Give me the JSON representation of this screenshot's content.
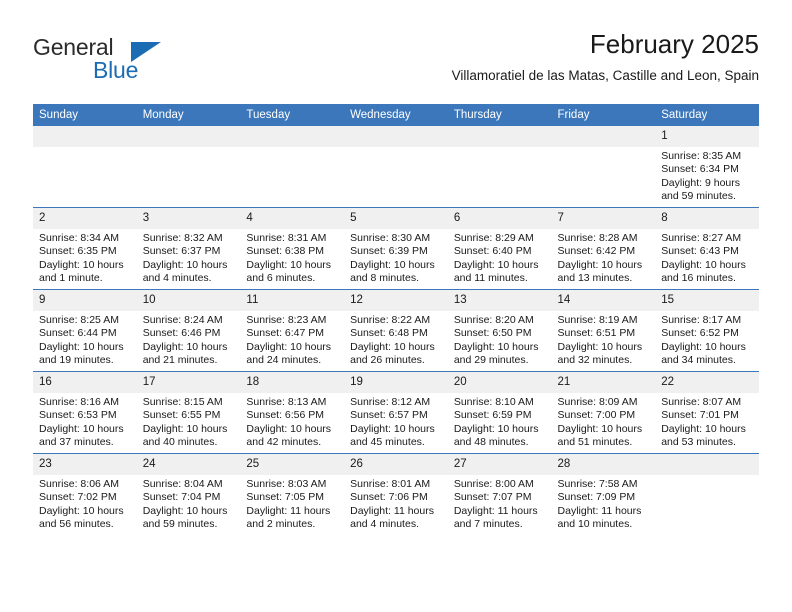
{
  "logo": {
    "word_1": "General",
    "word_2": "Blue",
    "triangle_icon": "blue-triangle-icon",
    "accent_color": "#1b6cb3"
  },
  "header": {
    "title": "February 2025",
    "subtitle": "Villamoratiel de las Matas, Castille and Leon, Spain"
  },
  "theme": {
    "header_blue": "#3b77ba",
    "daynum_gray": "#f0f0f0",
    "text": "#1a1a1a"
  },
  "calendar": {
    "weekday_headers": [
      "Sunday",
      "Monday",
      "Tuesday",
      "Wednesday",
      "Thursday",
      "Friday",
      "Saturday"
    ],
    "weeks": [
      [
        {
          "day": "",
          "sunrise": "",
          "sunset": "",
          "daylight_1": "",
          "daylight_2": ""
        },
        {
          "day": "",
          "sunrise": "",
          "sunset": "",
          "daylight_1": "",
          "daylight_2": ""
        },
        {
          "day": "",
          "sunrise": "",
          "sunset": "",
          "daylight_1": "",
          "daylight_2": ""
        },
        {
          "day": "",
          "sunrise": "",
          "sunset": "",
          "daylight_1": "",
          "daylight_2": ""
        },
        {
          "day": "",
          "sunrise": "",
          "sunset": "",
          "daylight_1": "",
          "daylight_2": ""
        },
        {
          "day": "",
          "sunrise": "",
          "sunset": "",
          "daylight_1": "",
          "daylight_2": ""
        },
        {
          "day": "1",
          "sunrise": "Sunrise: 8:35 AM",
          "sunset": "Sunset: 6:34 PM",
          "daylight_1": "Daylight: 9 hours",
          "daylight_2": "and 59 minutes."
        }
      ],
      [
        {
          "day": "2",
          "sunrise": "Sunrise: 8:34 AM",
          "sunset": "Sunset: 6:35 PM",
          "daylight_1": "Daylight: 10 hours",
          "daylight_2": "and 1 minute."
        },
        {
          "day": "3",
          "sunrise": "Sunrise: 8:32 AM",
          "sunset": "Sunset: 6:37 PM",
          "daylight_1": "Daylight: 10 hours",
          "daylight_2": "and 4 minutes."
        },
        {
          "day": "4",
          "sunrise": "Sunrise: 8:31 AM",
          "sunset": "Sunset: 6:38 PM",
          "daylight_1": "Daylight: 10 hours",
          "daylight_2": "and 6 minutes."
        },
        {
          "day": "5",
          "sunrise": "Sunrise: 8:30 AM",
          "sunset": "Sunset: 6:39 PM",
          "daylight_1": "Daylight: 10 hours",
          "daylight_2": "and 8 minutes."
        },
        {
          "day": "6",
          "sunrise": "Sunrise: 8:29 AM",
          "sunset": "Sunset: 6:40 PM",
          "daylight_1": "Daylight: 10 hours",
          "daylight_2": "and 11 minutes."
        },
        {
          "day": "7",
          "sunrise": "Sunrise: 8:28 AM",
          "sunset": "Sunset: 6:42 PM",
          "daylight_1": "Daylight: 10 hours",
          "daylight_2": "and 13 minutes."
        },
        {
          "day": "8",
          "sunrise": "Sunrise: 8:27 AM",
          "sunset": "Sunset: 6:43 PM",
          "daylight_1": "Daylight: 10 hours",
          "daylight_2": "and 16 minutes."
        }
      ],
      [
        {
          "day": "9",
          "sunrise": "Sunrise: 8:25 AM",
          "sunset": "Sunset: 6:44 PM",
          "daylight_1": "Daylight: 10 hours",
          "daylight_2": "and 19 minutes."
        },
        {
          "day": "10",
          "sunrise": "Sunrise: 8:24 AM",
          "sunset": "Sunset: 6:46 PM",
          "daylight_1": "Daylight: 10 hours",
          "daylight_2": "and 21 minutes."
        },
        {
          "day": "11",
          "sunrise": "Sunrise: 8:23 AM",
          "sunset": "Sunset: 6:47 PM",
          "daylight_1": "Daylight: 10 hours",
          "daylight_2": "and 24 minutes."
        },
        {
          "day": "12",
          "sunrise": "Sunrise: 8:22 AM",
          "sunset": "Sunset: 6:48 PM",
          "daylight_1": "Daylight: 10 hours",
          "daylight_2": "and 26 minutes."
        },
        {
          "day": "13",
          "sunrise": "Sunrise: 8:20 AM",
          "sunset": "Sunset: 6:50 PM",
          "daylight_1": "Daylight: 10 hours",
          "daylight_2": "and 29 minutes."
        },
        {
          "day": "14",
          "sunrise": "Sunrise: 8:19 AM",
          "sunset": "Sunset: 6:51 PM",
          "daylight_1": "Daylight: 10 hours",
          "daylight_2": "and 32 minutes."
        },
        {
          "day": "15",
          "sunrise": "Sunrise: 8:17 AM",
          "sunset": "Sunset: 6:52 PM",
          "daylight_1": "Daylight: 10 hours",
          "daylight_2": "and 34 minutes."
        }
      ],
      [
        {
          "day": "16",
          "sunrise": "Sunrise: 8:16 AM",
          "sunset": "Sunset: 6:53 PM",
          "daylight_1": "Daylight: 10 hours",
          "daylight_2": "and 37 minutes."
        },
        {
          "day": "17",
          "sunrise": "Sunrise: 8:15 AM",
          "sunset": "Sunset: 6:55 PM",
          "daylight_1": "Daylight: 10 hours",
          "daylight_2": "and 40 minutes."
        },
        {
          "day": "18",
          "sunrise": "Sunrise: 8:13 AM",
          "sunset": "Sunset: 6:56 PM",
          "daylight_1": "Daylight: 10 hours",
          "daylight_2": "and 42 minutes."
        },
        {
          "day": "19",
          "sunrise": "Sunrise: 8:12 AM",
          "sunset": "Sunset: 6:57 PM",
          "daylight_1": "Daylight: 10 hours",
          "daylight_2": "and 45 minutes."
        },
        {
          "day": "20",
          "sunrise": "Sunrise: 8:10 AM",
          "sunset": "Sunset: 6:59 PM",
          "daylight_1": "Daylight: 10 hours",
          "daylight_2": "and 48 minutes."
        },
        {
          "day": "21",
          "sunrise": "Sunrise: 8:09 AM",
          "sunset": "Sunset: 7:00 PM",
          "daylight_1": "Daylight: 10 hours",
          "daylight_2": "and 51 minutes."
        },
        {
          "day": "22",
          "sunrise": "Sunrise: 8:07 AM",
          "sunset": "Sunset: 7:01 PM",
          "daylight_1": "Daylight: 10 hours",
          "daylight_2": "and 53 minutes."
        }
      ],
      [
        {
          "day": "23",
          "sunrise": "Sunrise: 8:06 AM",
          "sunset": "Sunset: 7:02 PM",
          "daylight_1": "Daylight: 10 hours",
          "daylight_2": "and 56 minutes."
        },
        {
          "day": "24",
          "sunrise": "Sunrise: 8:04 AM",
          "sunset": "Sunset: 7:04 PM",
          "daylight_1": "Daylight: 10 hours",
          "daylight_2": "and 59 minutes."
        },
        {
          "day": "25",
          "sunrise": "Sunrise: 8:03 AM",
          "sunset": "Sunset: 7:05 PM",
          "daylight_1": "Daylight: 11 hours",
          "daylight_2": "and 2 minutes."
        },
        {
          "day": "26",
          "sunrise": "Sunrise: 8:01 AM",
          "sunset": "Sunset: 7:06 PM",
          "daylight_1": "Daylight: 11 hours",
          "daylight_2": "and 4 minutes."
        },
        {
          "day": "27",
          "sunrise": "Sunrise: 8:00 AM",
          "sunset": "Sunset: 7:07 PM",
          "daylight_1": "Daylight: 11 hours",
          "daylight_2": "and 7 minutes."
        },
        {
          "day": "28",
          "sunrise": "Sunrise: 7:58 AM",
          "sunset": "Sunset: 7:09 PM",
          "daylight_1": "Daylight: 11 hours",
          "daylight_2": "and 10 minutes."
        },
        {
          "day": "",
          "sunrise": "",
          "sunset": "",
          "daylight_1": "",
          "daylight_2": ""
        }
      ]
    ]
  }
}
